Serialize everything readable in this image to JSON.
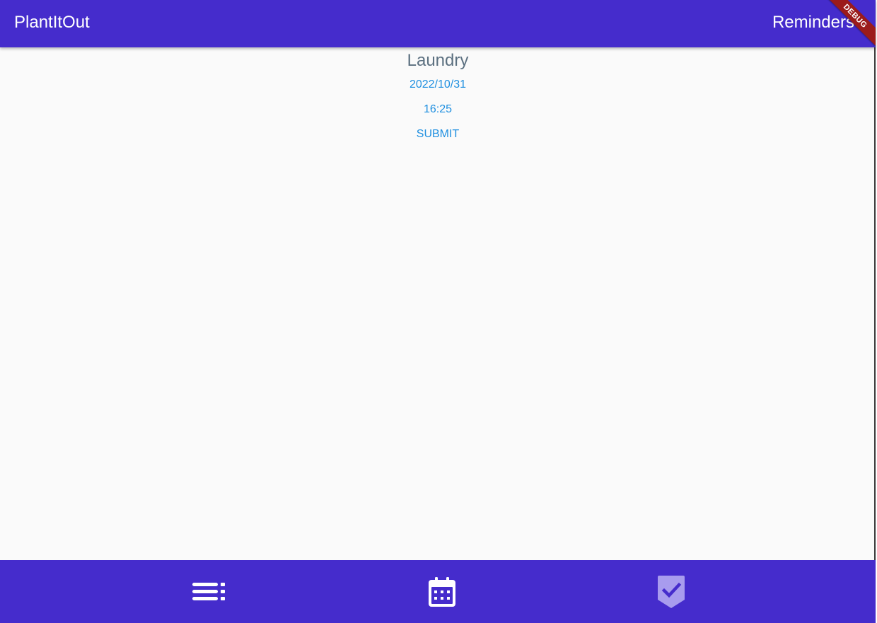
{
  "app_bar": {
    "title": "PlantItOut",
    "action_label": "Reminders",
    "debug_banner": "DEBUG",
    "background_color": "#452ccc"
  },
  "reminder": {
    "title": "Laundry",
    "date": "2022/10/31",
    "time": "16:25",
    "submit_label": "SUBMIT"
  },
  "bottom_nav": {
    "items": [
      {
        "icon": "list-icon",
        "selected": false
      },
      {
        "icon": "calendar-icon",
        "selected": false
      },
      {
        "icon": "task-check-icon",
        "selected": true
      }
    ]
  },
  "colors": {
    "accent": "#1e8fe0",
    "primary": "#452ccc",
    "title_text": "#5c7080",
    "background": "#fafafa"
  }
}
